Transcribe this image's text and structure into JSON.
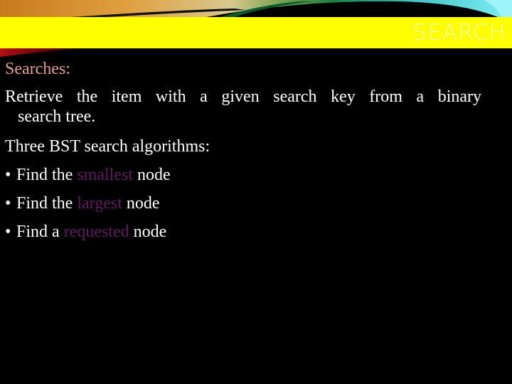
{
  "slide": {
    "title": "SEARCH",
    "colors": {
      "background": "#000000",
      "title_band": "#ffff00",
      "title_text": "#fffbb0",
      "heading_text": "#e0a090",
      "body_text": "#ffffff",
      "highlight_text": "#5c1a5e"
    },
    "heading": "Searches:",
    "paragraph": {
      "line1": "Retrieve the item with a given search key from a binary",
      "line2": "search tree."
    },
    "subheading": "Three BST search algorithms:",
    "bullet_symbol": "•",
    "bullets": [
      {
        "prefix": "Find the",
        "highlight": "smallest",
        "suffix": "node"
      },
      {
        "prefix": "Find the",
        "highlight": "largest",
        "suffix": "node"
      },
      {
        "prefix": "Find a",
        "highlight": "requested",
        "suffix": "node"
      }
    ]
  }
}
